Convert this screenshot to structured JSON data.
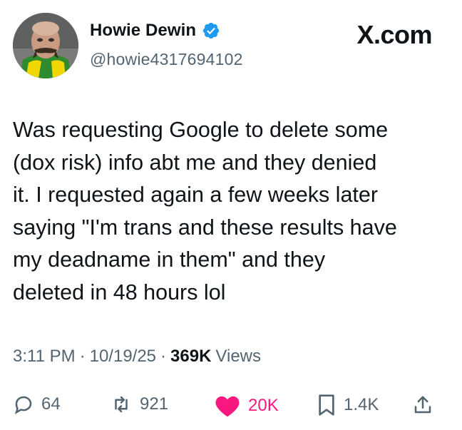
{
  "author": {
    "display_name": "Howie Dewin",
    "handle": "@howie4317694102",
    "verified": true,
    "avatar_icon": "profile-photo"
  },
  "brand": {
    "label": "X.com"
  },
  "tweet": {
    "lines": [
      "Was requesting Google to delete some",
      "(dox risk) info abt me and they denied",
      "it. I requested again a few weeks later",
      "saying \"I'm trans and these results have",
      "my deadname in them\" and they",
      "deleted in 48 hours lol"
    ]
  },
  "meta": {
    "time": "3:11 PM",
    "separator": "·",
    "date": "10/19/25",
    "views_count": "369K",
    "views_label": "Views"
  },
  "actions": {
    "replies": "64",
    "reposts": "921",
    "likes": "20K",
    "bookmarks": "1.4K"
  },
  "colors": {
    "text": "#0f1419",
    "secondary": "#536471",
    "like": "#f91880",
    "verified": "#1d9bf0"
  }
}
